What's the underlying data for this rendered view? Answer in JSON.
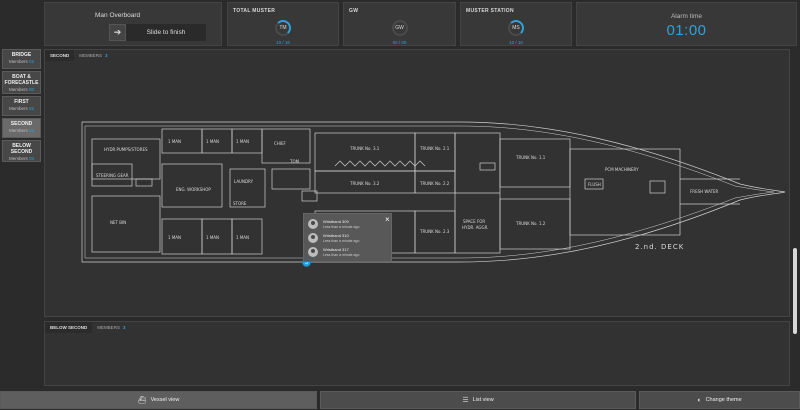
{
  "mob": {
    "title": "Man Overboard",
    "slide_label": "Slide to finish",
    "arrow_icon": "arrow-right-icon"
  },
  "stats": {
    "total": {
      "label": "TOTAL MUSTER",
      "code": "TM",
      "count": "10 / 16"
    },
    "gw": {
      "label": "GW",
      "code": "GW",
      "count": "00 / 00"
    },
    "station": {
      "label": "MUSTER STATION",
      "code": "MS",
      "count": "10 / 16"
    }
  },
  "alarm": {
    "label": "Alarm time",
    "time": "01:00"
  },
  "decks": [
    {
      "name": "BRIDGE",
      "members_label": "Members",
      "count": "02"
    },
    {
      "name": "BOAT & FORECASTLE",
      "members_label": "Members",
      "count": "00"
    },
    {
      "name": "FIRST",
      "members_label": "Members",
      "count": "02"
    },
    {
      "name": "SECOND",
      "members_label": "Members",
      "count": "03"
    },
    {
      "name": "BELOW SECOND",
      "members_label": "Members",
      "count": "03"
    }
  ],
  "second_panel": {
    "tab": "SECOND",
    "members_label": "MEMBERS",
    "count": "3"
  },
  "below_panel": {
    "tab": "BELOW SECOND",
    "members_label": "MEMBERS",
    "count": "3"
  },
  "plan": {
    "deck_label": "2.nd. DECK",
    "rooms": {
      "hydr": "HYDR.PUMPS/STORES",
      "steering": "STEERING GEAR",
      "net_bin": "NET BIN",
      "man1": "1 MAN",
      "man2": "1 MAN",
      "man3": "1 MAN",
      "man4": "1 MAN",
      "man5": "1 MAN",
      "man6": "1 MAN",
      "chief": "CHIEF",
      "eng_workshop": "ENG. WORKSHOP",
      "laundry": "LAUNDRY",
      "store": "STORE",
      "store2": "STORE",
      "tom": "TOM",
      "trunk31": "TRUNK No. 3.1",
      "trunk32": "TRUNK No. 3.2",
      "trunk33": "TRUNK No. 3.3",
      "trunk21": "TRUNK No. 2.1",
      "trunk22": "TRUNK No. 2.2",
      "trunk23": "TRUNK No. 2.3",
      "trunk11": "TRUNK No. 1.1",
      "trunk12": "TRUNK No. 1.2",
      "space": "SPACE FOR",
      "space2": "HYDR. AGGR.",
      "pcm": "PCM MACHINERY",
      "fresh": "FRESH WATER",
      "flush": "FLUSH"
    }
  },
  "popup": {
    "badge": "3",
    "people": [
      {
        "name": "Wristband 309",
        "time": "Less than a minute ago"
      },
      {
        "name": "Wristband 310",
        "time": "Less than a minute ago"
      },
      {
        "name": "Wristband 317",
        "time": "Less than a minute ago"
      }
    ]
  },
  "bottom": {
    "vessel": "Vessel view",
    "list": "List view",
    "theme": "Change theme"
  },
  "colors": {
    "accent": "#2aa3dc",
    "background": "#2b2b2b",
    "panel": "#383838"
  }
}
